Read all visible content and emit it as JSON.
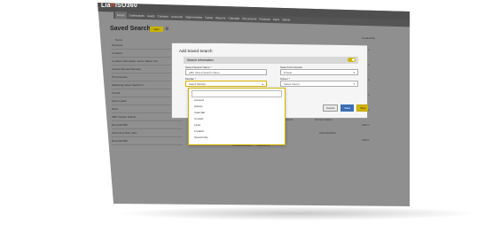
{
  "app": {
    "logo_prefix": "Lia",
    "logo_mark": "R",
    "logo_suffix": "ISO360"
  },
  "nav": {
    "items": [
      "Home",
      "Dashboards",
      "Leads",
      "Contacts",
      "Accounts",
      "Opportunities",
      "Cases",
      "Reports",
      "Calendar",
      "Documents",
      "Products",
      "More",
      "Admin"
    ]
  },
  "page": {
    "title": "Saved Search",
    "new_button": "New"
  },
  "filters": {
    "left_label": "Name",
    "right_label": "Created By"
  },
  "rows": [
    "Accounts",
    "Contacts",
    "Location Information, Active Status Yes",
    "Closed Opened Records",
    "ITS Accounts",
    "Marketing Active Search In",
    "Unsold",
    "Open Leads",
    "Open",
    "ABC Tracker Submit",
    "Records/ABC",
    "Upcoming Task_Vars",
    "Records/ABC"
  ],
  "right_col": [
    "Admin",
    "Admin",
    "Admin",
    "Admin",
    "Admin",
    "Admin",
    "Admin"
  ],
  "extras": [
    "Accounts",
    "Account Name",
    "Administration",
    "Contact Account",
    "Data Entry"
  ],
  "modal": {
    "title": "Add Saved Search",
    "section": "Search Information",
    "name_label": "Saved Search Name *",
    "name_value": "ABC Saved Search Name",
    "permission_label": "Search Permission",
    "permission_value": "Private",
    "module_label": "Module *",
    "module_placeholder": "Select Module",
    "owner_label": "Owner *",
    "owner_value": "Select Owner",
    "cancel": "Cancel",
    "save": "Save",
    "next": "Next"
  },
  "dropdown": [
    "Account",
    "Activity",
    "Calendar",
    "Contact",
    "Lead",
    "Location",
    "Opportunity"
  ]
}
